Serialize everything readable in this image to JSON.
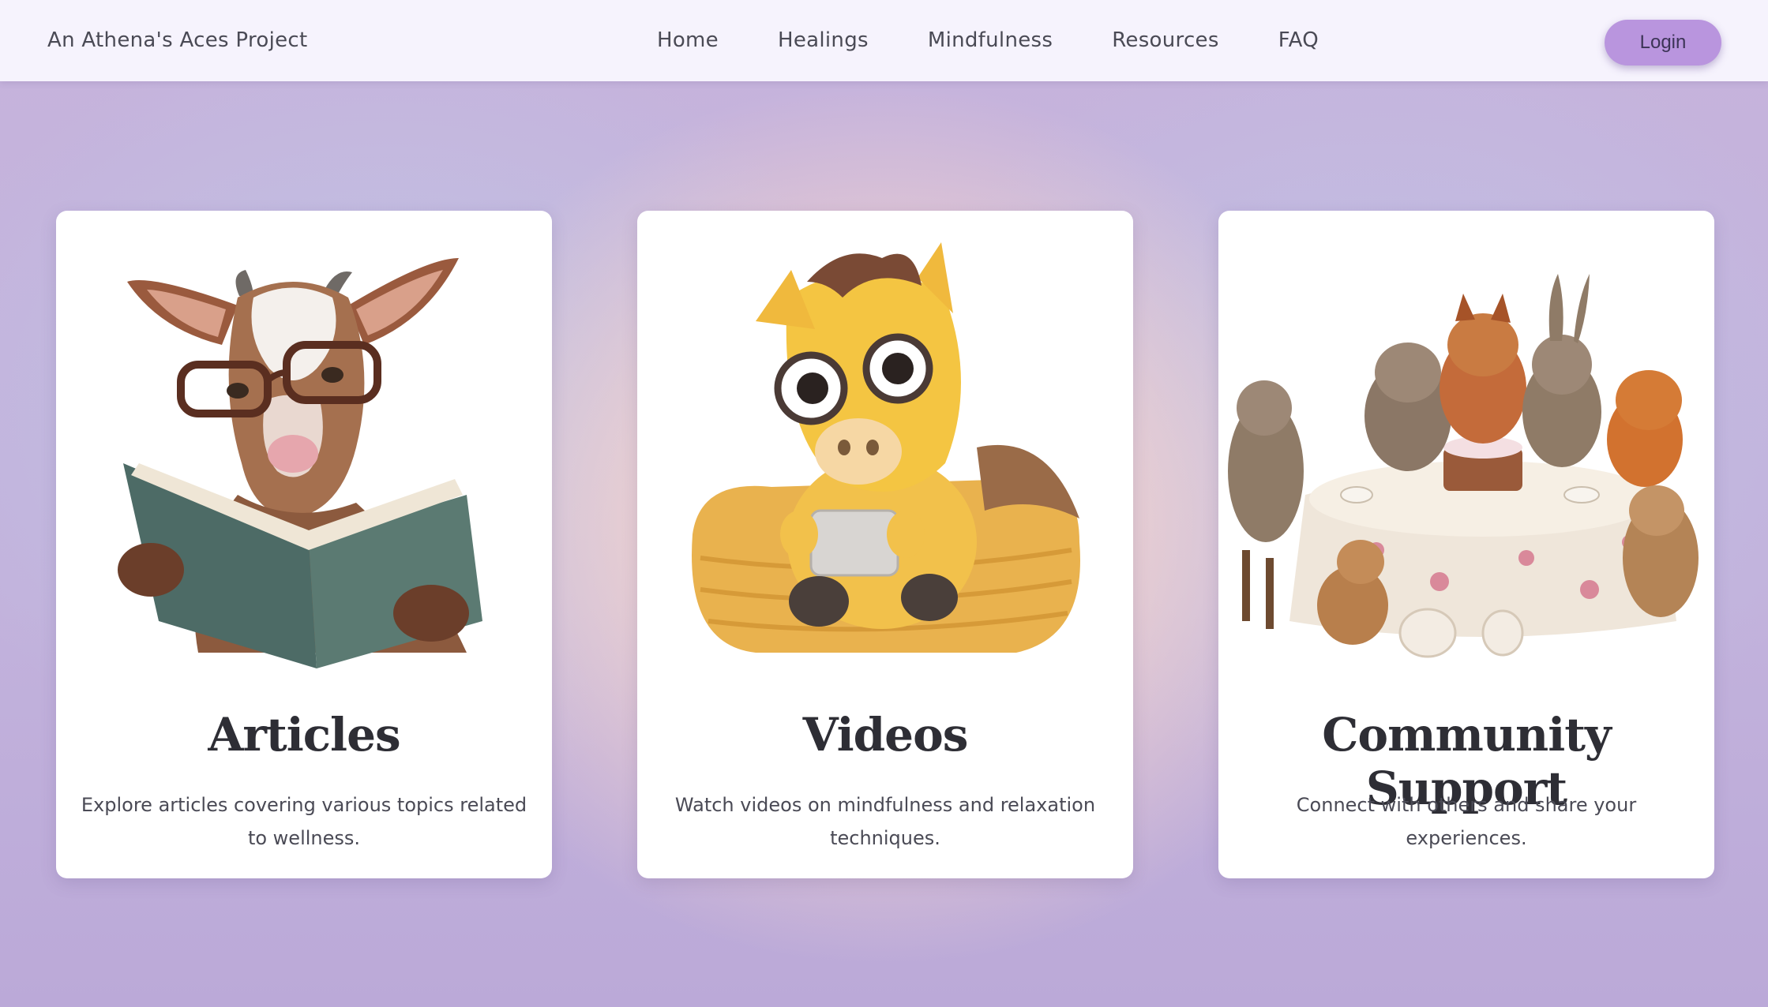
{
  "header": {
    "brand": "An Athena's Aces Project",
    "nav": [
      "Home",
      "Healings",
      "Mindfulness",
      "Resources",
      "FAQ"
    ],
    "login_label": "Login"
  },
  "cards": [
    {
      "title": "Articles",
      "description": "Explore articles covering various topics related to wellness."
    },
    {
      "title": "Videos",
      "description": "Watch videos on mindfulness and relaxation techniques."
    },
    {
      "title": "Community Support",
      "description": "Connect with others and share your experiences."
    }
  ],
  "colors": {
    "accent": "#b995de",
    "topbar": "#f6f3fd",
    "text": "#4a4a55",
    "title": "#2e2e35"
  }
}
